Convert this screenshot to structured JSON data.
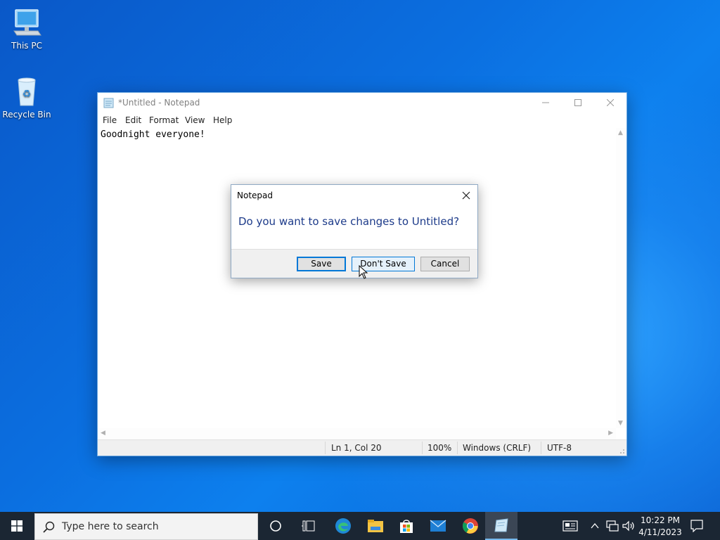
{
  "desktop": {
    "icons": [
      {
        "label": "This PC"
      },
      {
        "label": "Recycle Bin"
      }
    ]
  },
  "notepad": {
    "title": "*Untitled - Notepad",
    "menu": [
      "File",
      "Edit",
      "Format",
      "View",
      "Help"
    ],
    "content": "Goodnight everyone!",
    "status": {
      "position": "Ln 1, Col 20",
      "zoom": "100%",
      "line_ending": "Windows (CRLF)",
      "encoding": "UTF-8"
    }
  },
  "dialog": {
    "title": "Notepad",
    "message": "Do you want to save changes to Untitled?",
    "buttons": {
      "save": "Save",
      "dont_save": "Don't Save",
      "cancel": "Cancel"
    }
  },
  "taskbar": {
    "search_placeholder": "Type here to search",
    "pinned": [
      "cortana-icon",
      "task-view-icon",
      "edge-icon",
      "file-explorer-icon",
      "store-icon",
      "mail-icon",
      "chrome-icon",
      "notepad-icon"
    ],
    "clock": {
      "time": "10:22 PM",
      "date": "4/11/2023"
    }
  },
  "colors": {
    "accent": "#0078d7",
    "dialog_text": "#1d3b8a",
    "taskbar": "#1b2633"
  }
}
